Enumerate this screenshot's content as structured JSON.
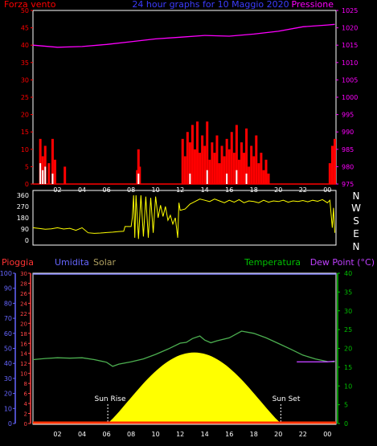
{
  "header": {
    "left_label": "Forza vento",
    "title": "24 hour graphs for 10 Maggio 2020",
    "right_label": "Pressione"
  },
  "compass": [
    "N",
    "W",
    "S",
    "E",
    "N"
  ],
  "sun": {
    "rise_label": "Sun Rise",
    "set_label": "Sun Set"
  },
  "colors": {
    "wind": "#ff0000",
    "gust_fill": "#ffffff",
    "wind_green": "#00c000",
    "pressure": "#ff00ff",
    "direction": "#ffff00",
    "temperature": "#4caf50",
    "dewpoint": "#c040ff",
    "solar": "#ffff00",
    "humidity_axis": "#6666ff",
    "rain_axis": "#ff4444",
    "temp_axis": "#00c000",
    "axis": "#ffffff"
  },
  "chart_data": [
    {
      "type": "bar",
      "name": "wind_pressure",
      "x_ticks": [
        "02",
        "04",
        "06",
        "08",
        "10",
        "12",
        "14",
        "16",
        "18",
        "20",
        "22",
        "00"
      ],
      "wind_axis": {
        "ticks": [
          "0",
          "5",
          "10",
          "15",
          "20",
          "25",
          "30",
          "35",
          "40",
          "45",
          "50"
        ],
        "ylim": [
          0,
          50
        ]
      },
      "pressure_axis": {
        "ticks": [
          "975",
          "980",
          "985",
          "990",
          "995",
          "1000",
          "1005",
          "1010",
          "1015",
          "1020",
          "1025"
        ],
        "ylim": [
          975,
          1025
        ]
      },
      "wind_points": [
        [
          0.6,
          13
        ],
        [
          0.8,
          8
        ],
        [
          1.0,
          11
        ],
        [
          1.3,
          6
        ],
        [
          1.6,
          13
        ],
        [
          1.8,
          7
        ],
        [
          2.6,
          5
        ],
        [
          8.5,
          4
        ],
        [
          8.6,
          10
        ],
        [
          8.7,
          5
        ],
        [
          12.2,
          13
        ],
        [
          12.4,
          8
        ],
        [
          12.6,
          15
        ],
        [
          12.8,
          12
        ],
        [
          13.0,
          17
        ],
        [
          13.2,
          10
        ],
        [
          13.4,
          18
        ],
        [
          13.6,
          9
        ],
        [
          13.8,
          14
        ],
        [
          14.0,
          11
        ],
        [
          14.2,
          18
        ],
        [
          14.4,
          7
        ],
        [
          14.6,
          12
        ],
        [
          14.8,
          9
        ],
        [
          15.0,
          14
        ],
        [
          15.2,
          6
        ],
        [
          15.4,
          11
        ],
        [
          15.6,
          8
        ],
        [
          15.8,
          13
        ],
        [
          16.0,
          10
        ],
        [
          16.2,
          15
        ],
        [
          16.4,
          9
        ],
        [
          16.6,
          17
        ],
        [
          16.8,
          7
        ],
        [
          17.0,
          12
        ],
        [
          17.2,
          9
        ],
        [
          17.4,
          16
        ],
        [
          17.6,
          5
        ],
        [
          17.8,
          11
        ],
        [
          18.0,
          8
        ],
        [
          18.2,
          14
        ],
        [
          18.4,
          6
        ],
        [
          18.6,
          9
        ],
        [
          18.8,
          4
        ],
        [
          19.0,
          7
        ],
        [
          19.2,
          3
        ],
        [
          24.2,
          6
        ],
        [
          24.4,
          11
        ],
        [
          24.6,
          13
        ]
      ],
      "gust_points": [
        [
          0.6,
          6
        ],
        [
          0.8,
          4
        ],
        [
          1.0,
          5
        ],
        [
          1.6,
          3
        ],
        [
          8.6,
          3
        ],
        [
          12.8,
          3
        ],
        [
          14.2,
          4
        ],
        [
          15.8,
          3
        ],
        [
          16.6,
          4
        ],
        [
          17.4,
          3
        ]
      ],
      "pressure_series": [
        [
          0,
          1015
        ],
        [
          2,
          1014.4
        ],
        [
          4,
          1014.6
        ],
        [
          6,
          1015.2
        ],
        [
          8,
          1016
        ],
        [
          10,
          1016.8
        ],
        [
          12,
          1017.3
        ],
        [
          14,
          1017.8
        ],
        [
          16,
          1017.6
        ],
        [
          18,
          1018.2
        ],
        [
          20,
          1019
        ],
        [
          22,
          1020.3
        ],
        [
          24,
          1020.8
        ],
        [
          24.6,
          1021
        ]
      ]
    },
    {
      "type": "line",
      "name": "wind_direction",
      "y_ticks": [
        "360",
        "270",
        "180",
        "90",
        "0"
      ],
      "ylim": [
        0,
        360
      ],
      "direction_series": [
        [
          0,
          100
        ],
        [
          0.5,
          95
        ],
        [
          1,
          88
        ],
        [
          1.5,
          92
        ],
        [
          2,
          100
        ],
        [
          2.5,
          90
        ],
        [
          3,
          96
        ],
        [
          3.5,
          80
        ],
        [
          4,
          100
        ],
        [
          4.5,
          60
        ],
        [
          5,
          55
        ],
        [
          5.5,
          58
        ],
        [
          6,
          62
        ],
        [
          6.5,
          65
        ],
        [
          7,
          70
        ],
        [
          7.4,
          72
        ],
        [
          7.5,
          110
        ],
        [
          8.0,
          110
        ],
        [
          8.1,
          180
        ],
        [
          8.2,
          360
        ],
        [
          8.3,
          20
        ],
        [
          8.4,
          360
        ],
        [
          8.6,
          10
        ],
        [
          8.8,
          360
        ],
        [
          9.0,
          30
        ],
        [
          9.2,
          350
        ],
        [
          9.4,
          20
        ],
        [
          9.6,
          340
        ],
        [
          9.8,
          60
        ],
        [
          10.0,
          350
        ],
        [
          10.2,
          180
        ],
        [
          10.4,
          280
        ],
        [
          10.6,
          190
        ],
        [
          10.8,
          270
        ],
        [
          11.0,
          160
        ],
        [
          11.2,
          200
        ],
        [
          11.4,
          130
        ],
        [
          11.6,
          180
        ],
        [
          11.8,
          20
        ],
        [
          11.9,
          300
        ],
        [
          12.0,
          240
        ],
        [
          12.4,
          250
        ],
        [
          12.8,
          290
        ],
        [
          13.2,
          310
        ],
        [
          13.6,
          330
        ],
        [
          14.0,
          320
        ],
        [
          14.4,
          310
        ],
        [
          14.8,
          330
        ],
        [
          15.2,
          315
        ],
        [
          15.6,
          300
        ],
        [
          16.0,
          320
        ],
        [
          16.4,
          305
        ],
        [
          16.8,
          325
        ],
        [
          17.2,
          300
        ],
        [
          17.6,
          315
        ],
        [
          18.0,
          310
        ],
        [
          18.4,
          300
        ],
        [
          18.8,
          320
        ],
        [
          19.2,
          305
        ],
        [
          19.6,
          315
        ],
        [
          20.0,
          310
        ],
        [
          20.4,
          320
        ],
        [
          20.8,
          305
        ],
        [
          21.2,
          315
        ],
        [
          21.6,
          310
        ],
        [
          22.0,
          318
        ],
        [
          22.4,
          308
        ],
        [
          22.8,
          320
        ],
        [
          23.2,
          312
        ],
        [
          23.6,
          325
        ],
        [
          24.0,
          300
        ],
        [
          24.2,
          320
        ],
        [
          24.4,
          100
        ],
        [
          24.5,
          260
        ],
        [
          24.6,
          60
        ]
      ]
    },
    {
      "type": "area",
      "name": "rain_humidity_solar_temperature",
      "legend": {
        "rain": "Pioggia",
        "humidity": "Umidita",
        "solar": "Solar",
        "temperature": "Temperatura",
        "dewpoint": "Dew Point (°C)"
      },
      "humidity_axis": {
        "ticks": [
          "0",
          "10",
          "20",
          "30",
          "40",
          "50",
          "60",
          "70",
          "80",
          "90",
          "100"
        ],
        "ylim": [
          0,
          100
        ]
      },
      "rain_axis": {
        "ticks": [
          "0",
          "2",
          "4",
          "6",
          "8",
          "10",
          "12",
          "14",
          "16",
          "18",
          "20",
          "22",
          "24",
          "26",
          "28",
          "30"
        ],
        "ylim": [
          0,
          30
        ]
      },
      "temp_axis": {
        "ticks": [
          "0",
          "5",
          "10",
          "15",
          "20",
          "25",
          "30",
          "35",
          "40"
        ],
        "ylim": [
          0,
          40
        ]
      },
      "x_ticks": [
        "02",
        "04",
        "06",
        "08",
        "10",
        "12",
        "14",
        "16",
        "18",
        "20",
        "22",
        "00"
      ],
      "sun_rise_hour": 6.1,
      "sun_set_hour": 20.2,
      "solar_peak": 18.8,
      "temperature_series": [
        [
          0,
          17
        ],
        [
          1,
          17.3
        ],
        [
          2,
          17.5
        ],
        [
          3,
          17.4
        ],
        [
          4,
          17.5
        ],
        [
          5,
          17
        ],
        [
          6,
          16.3
        ],
        [
          6.5,
          15.2
        ],
        [
          7,
          15.8
        ],
        [
          8,
          16.4
        ],
        [
          9,
          17.2
        ],
        [
          10,
          18.4
        ],
        [
          11,
          19.8
        ],
        [
          12,
          21.4
        ],
        [
          12.5,
          21.6
        ],
        [
          13,
          22.6
        ],
        [
          13.6,
          23.3
        ],
        [
          14,
          22.2
        ],
        [
          14.5,
          21.5
        ],
        [
          15,
          22
        ],
        [
          16,
          22.8
        ],
        [
          17,
          24.6
        ],
        [
          18,
          24
        ],
        [
          19,
          22.8
        ],
        [
          20,
          21.3
        ],
        [
          21,
          19.8
        ],
        [
          22,
          18.2
        ],
        [
          23,
          17.2
        ],
        [
          24,
          16.5
        ],
        [
          24.6,
          16.4
        ]
      ],
      "dewpoint_series": [
        [
          21.5,
          16.4
        ],
        [
          23,
          16.4
        ],
        [
          24,
          16.4
        ],
        [
          24.6,
          16.6
        ]
      ],
      "rain_value": 0
    }
  ]
}
